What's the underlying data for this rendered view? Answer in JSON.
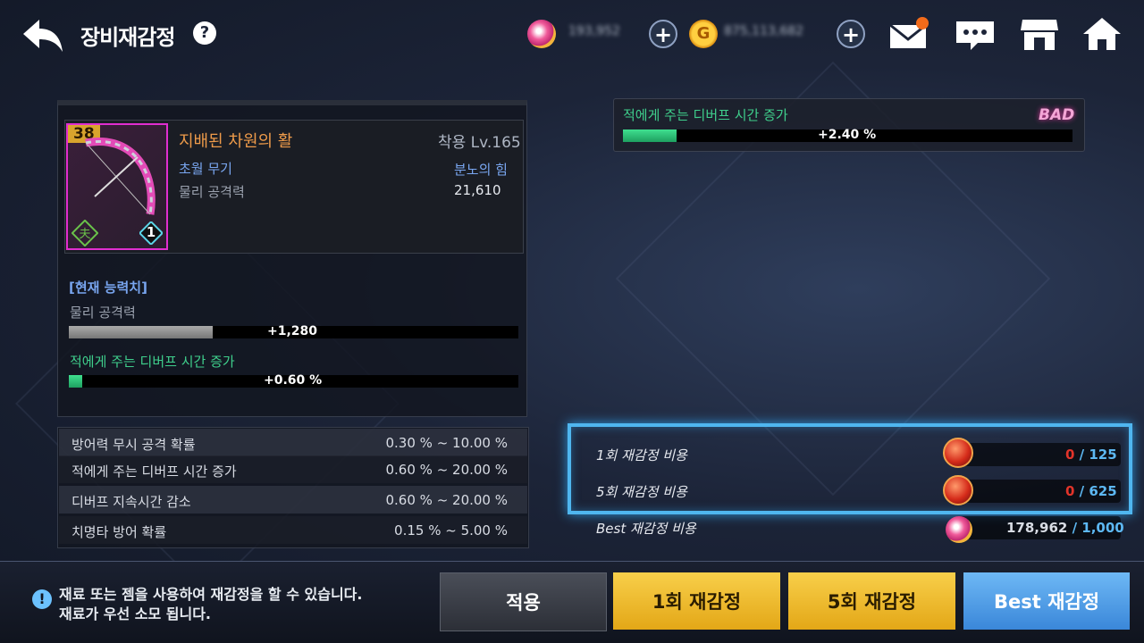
{
  "header": {
    "title": "장비재감정",
    "help_icon": "question-icon",
    "currency1": "193,952",
    "currency2": "875,113,682",
    "icons": [
      "mail-icon",
      "chat-icon",
      "shop-icon",
      "home-icon"
    ]
  },
  "item": {
    "level": "38",
    "name": "지배된 차원의 활",
    "req_level": "착용 Lv.165",
    "type": "초월 무기",
    "attr_label": "물리 공격력",
    "set_name": "분노의 힘",
    "attack": "21,610",
    "slot_number": "1"
  },
  "current_stats": {
    "heading": "[현재 능력치]",
    "stat1_label": "물리 공격력",
    "stat1_value": "+1,280",
    "stat1_fill_pct": 32,
    "stat2_label": "적에게 주는 디버프 시간 증가",
    "stat2_value": "+0.60 %",
    "stat2_fill_pct": 3
  },
  "ranges": [
    {
      "label": "방어력 무시 공격 확률",
      "value": "0.30 % ~ 10.00 %"
    },
    {
      "label": "적에게 주는 디버프 시간 증가",
      "value": "0.60 % ~ 20.00 %"
    },
    {
      "label": "디버프 지속시간 감소",
      "value": "0.60 % ~ 20.00 %"
    },
    {
      "label": "치명타 방어 확률",
      "value": "0.15 % ~ 5.00 %"
    }
  ],
  "result": {
    "label": "적에게 주는 디버프 시간 증가",
    "grade": "BAD",
    "value": "+2.40 %",
    "fill_pct": 12
  },
  "costs": {
    "one_label": "1회 재감정 비용",
    "one_have": "0",
    "one_need": "/ 125",
    "five_label": "5회 재감정 비용",
    "five_have": "0",
    "five_need": "/ 625",
    "best_label": "Best 재감정 비용",
    "best_have": "178,962",
    "best_need": "/ 1,000"
  },
  "footer": {
    "notice_line1": "재료 또는 젬을 사용하여 재감정을 할 수 있습니다.",
    "notice_line2": "재료가 우선 소모 됩니다.",
    "apply": "적용",
    "once": "1회 재감정",
    "five": "5회 재감정",
    "best": "Best 재감정"
  }
}
